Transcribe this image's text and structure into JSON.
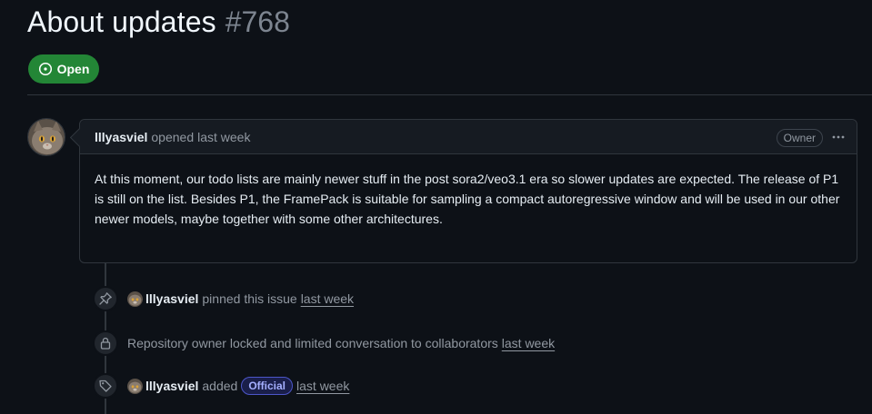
{
  "issue": {
    "title": "About updates",
    "number": "#768",
    "state": "Open"
  },
  "comment": {
    "author": "lllyasviel",
    "action": "opened",
    "time": "last week",
    "role_badge": "Owner",
    "body": "At this moment, our todo lists are mainly newer stuff in the post sora2/veo3.1 era so slower updates are expected. The release of P1 is still on the list. Besides P1, the FramePack is suitable for sampling a compact autoregressive window and will be used in our other newer models, maybe together with some other architectures."
  },
  "timeline": [
    {
      "icon": "pin-icon",
      "author": "lllyasviel",
      "text": "pinned this issue",
      "time": "last week"
    },
    {
      "icon": "lock-icon",
      "text": "Repository owner locked and limited conversation to collaborators",
      "time": "last week"
    },
    {
      "icon": "tag-icon",
      "author": "lllyasviel",
      "text": "added",
      "label": "Official",
      "time": "last week"
    }
  ],
  "colors": {
    "background": "#0d1117",
    "open_green": "#238636",
    "label_official": "#4c56c9"
  }
}
